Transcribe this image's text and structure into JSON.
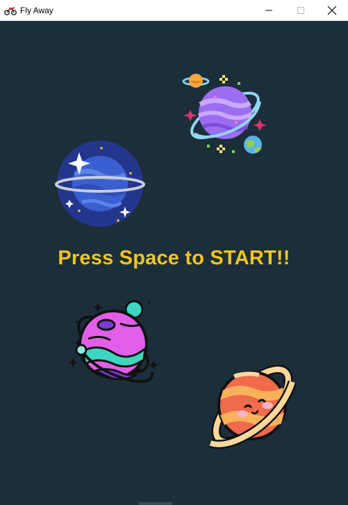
{
  "window": {
    "title": "Fly Away",
    "app_icon": "motorcycle-icon",
    "controls": [
      "minimize-icon",
      "maximize-icon",
      "close-icon"
    ]
  },
  "game": {
    "prompt_text": "Press Space to START!!",
    "prompt_color": "#f5c518",
    "background_color": "#1c2e3a",
    "sprites": [
      "purple-ringed-planet",
      "blue-planet",
      "pink-teal-planet",
      "orange-saturn-planet"
    ]
  }
}
